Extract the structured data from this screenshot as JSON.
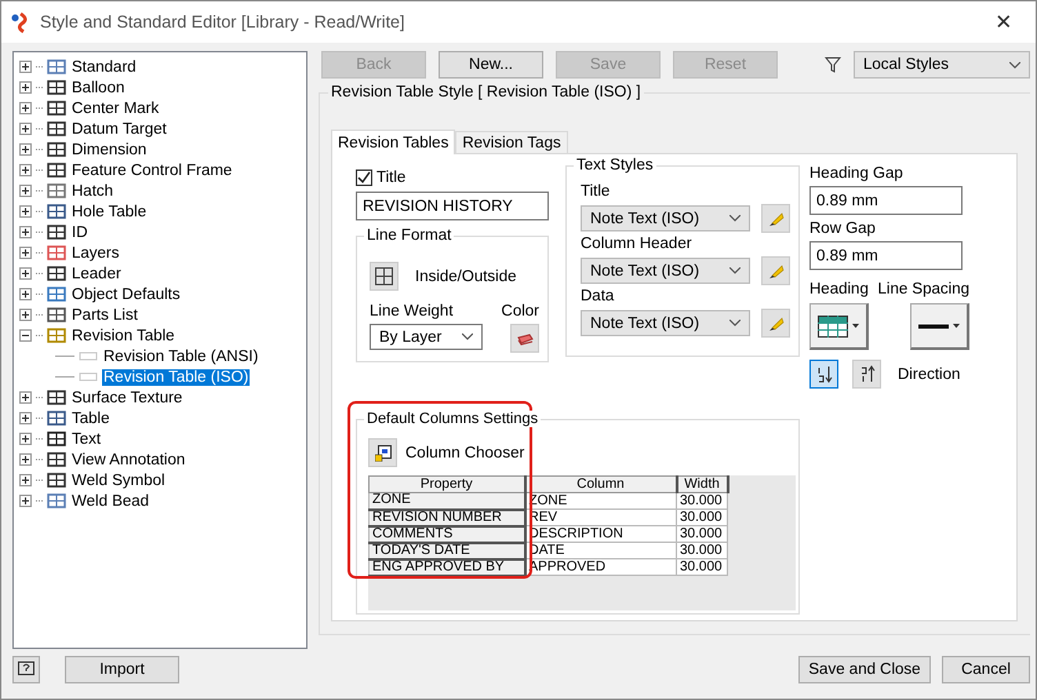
{
  "window": {
    "title": "Style and Standard Editor [Library - Read/Write]",
    "close": "✕"
  },
  "tree": {
    "items": [
      {
        "label": "Standard",
        "expanded": false,
        "selected": false
      },
      {
        "label": "Balloon",
        "expanded": false,
        "selected": false
      },
      {
        "label": "Center Mark",
        "expanded": false,
        "selected": false
      },
      {
        "label": "Datum Target",
        "expanded": false,
        "selected": false
      },
      {
        "label": "Dimension",
        "expanded": false,
        "selected": false
      },
      {
        "label": "Feature Control Frame",
        "expanded": false,
        "selected": false
      },
      {
        "label": "Hatch",
        "expanded": false,
        "selected": false
      },
      {
        "label": "Hole Table",
        "expanded": false,
        "selected": false
      },
      {
        "label": "ID",
        "expanded": false,
        "selected": false
      },
      {
        "label": "Layers",
        "expanded": false,
        "selected": false
      },
      {
        "label": "Leader",
        "expanded": false,
        "selected": false
      },
      {
        "label": "Object Defaults",
        "expanded": false,
        "selected": false
      },
      {
        "label": "Parts List",
        "expanded": false,
        "selected": false
      },
      {
        "label": "Revision Table",
        "expanded": true,
        "selected": false,
        "children": [
          {
            "label": "Revision Table (ANSI)",
            "selected": false
          },
          {
            "label": "Revision Table (ISO)",
            "selected": true
          }
        ]
      },
      {
        "label": "Surface Texture",
        "expanded": false,
        "selected": false
      },
      {
        "label": "Table",
        "expanded": false,
        "selected": false
      },
      {
        "label": "Text",
        "expanded": false,
        "selected": false
      },
      {
        "label": "View Annotation",
        "expanded": false,
        "selected": false
      },
      {
        "label": "Weld Symbol",
        "expanded": false,
        "selected": false
      },
      {
        "label": "Weld Bead",
        "expanded": false,
        "selected": false
      }
    ]
  },
  "toolbar": {
    "buttons": [
      {
        "label": "Back",
        "disabled": true
      },
      {
        "label": "New...",
        "disabled": false
      },
      {
        "label": "Save",
        "disabled": true
      },
      {
        "label": "Reset",
        "disabled": true
      }
    ],
    "filter": {
      "value": "Local Styles"
    }
  },
  "style_group": {
    "title": "Revision Table Style [ Revision Table (ISO) ]"
  },
  "tabs": [
    {
      "label": "Revision Tables",
      "selected": true
    },
    {
      "label": "Revision Tags",
      "selected": false
    }
  ],
  "title_option": {
    "label": "Title",
    "checked": true,
    "value": "REVISION HISTORY"
  },
  "line_format": {
    "title": "Line Format",
    "pattern_label": "Inside/Outside",
    "line_weight_label": "Line Weight",
    "line_weight_value": "By Layer",
    "color_label": "Color"
  },
  "text_styles": {
    "title": "Text Styles",
    "rows": [
      {
        "label": "Title",
        "value": "Note Text (ISO)"
      },
      {
        "label": "Column Header",
        "value": "Note Text (ISO)"
      },
      {
        "label": "Data",
        "value": "Note Text (ISO)"
      }
    ]
  },
  "heading_gap": {
    "label": "Heading Gap",
    "value": "0.89 mm"
  },
  "row_gap": {
    "label": "Row Gap",
    "value": "0.89 mm"
  },
  "heading": {
    "label": "Heading"
  },
  "line_spacing": {
    "label": "Line Spacing"
  },
  "direction": {
    "label": "Direction",
    "options": [
      {
        "selected": true
      },
      {
        "selected": false
      }
    ]
  },
  "default_columns": {
    "title": "Default Columns Settings",
    "chooser_label": "Column Chooser",
    "columns": [
      "Property",
      "Column",
      "Width"
    ],
    "rows": [
      [
        "ZONE",
        "ZONE",
        "30.000"
      ],
      [
        "REVISION NUMBER",
        "REV",
        "30.000"
      ],
      [
        "COMMENTS",
        "DESCRIPTION",
        "30.000"
      ],
      [
        "TODAY'S DATE",
        "DATE",
        "30.000"
      ],
      [
        "ENG APPROVED BY",
        "APPROVED",
        "30.000"
      ]
    ]
  },
  "footer": {
    "left_buttons": [
      {
        "label": "Import"
      }
    ],
    "right_buttons": [
      {
        "label": "Save and Close"
      },
      {
        "label": "Cancel"
      }
    ]
  }
}
